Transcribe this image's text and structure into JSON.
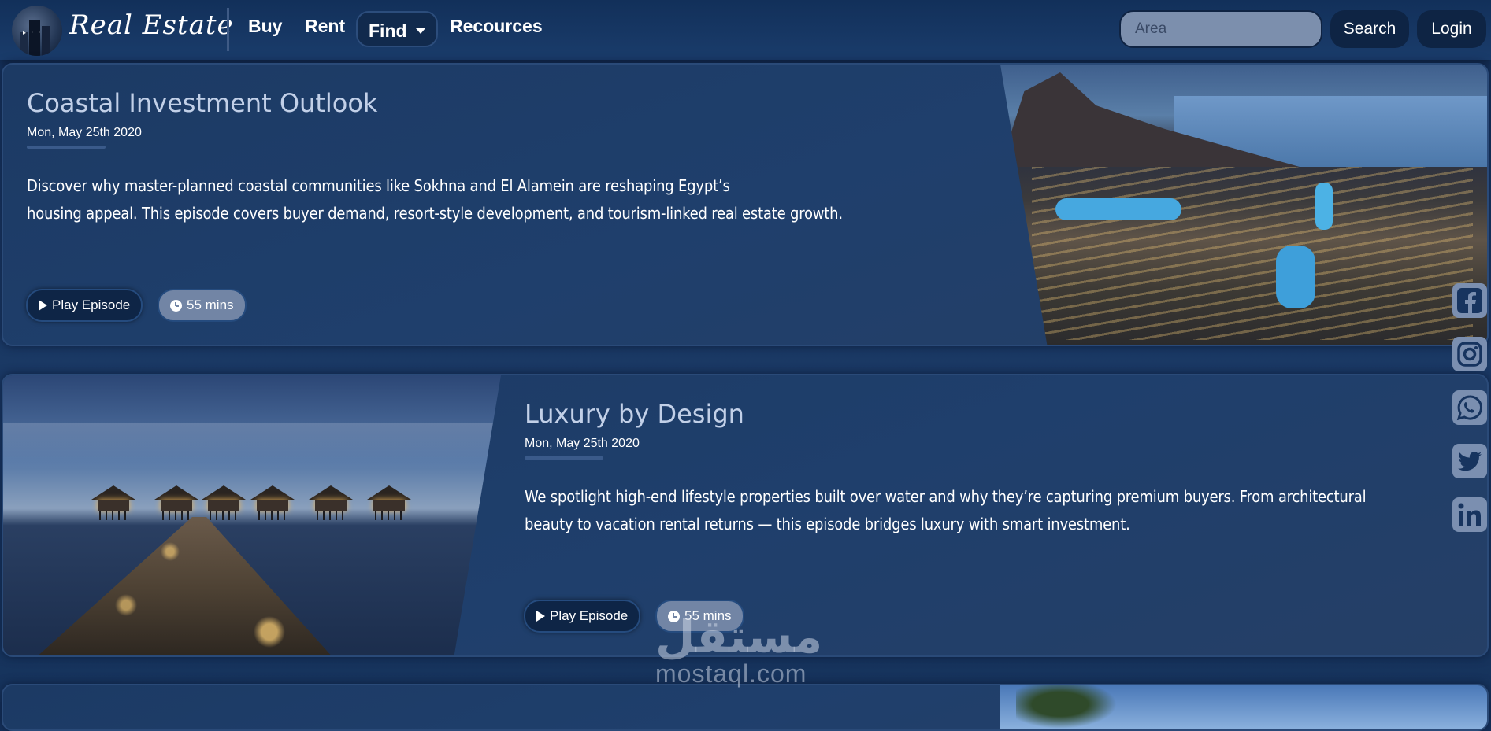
{
  "nav": {
    "brand": "Real Estate",
    "links": [
      "Buy",
      "Rent",
      "Find",
      "Recources"
    ],
    "search_placeholder": "Area",
    "search_label": "Search",
    "login_label": "Login"
  },
  "episodes": [
    {
      "title": "Coastal Investment Outlook",
      "date": "Mon, May 25th 2020",
      "description_line1": "Discover why master-planned coastal communities like Sokhna and El Alamein are reshaping Egypt’s",
      "description_line2": "housing appeal. This episode covers buyer demand, resort-style development, and tourism-linked real estate growth.",
      "play_label": "Play Episode",
      "duration": "55 mins"
    },
    {
      "title": "Luxury by Design",
      "date": "Mon, May 25th 2020",
      "description_line1": "We spotlight high-end lifestyle properties built over water and why they’re capturing premium buyers. From architectural",
      "description_line2": "beauty to vacation rental returns — this episode bridges luxury with smart investment.",
      "play_label": "Play Episode",
      "duration": "55 mins"
    }
  ],
  "social": [
    "facebook-icon",
    "instagram-icon",
    "whatsapp-icon",
    "twitter-icon",
    "linkedin-icon"
  ],
  "watermark": {
    "arabic": "مستقل",
    "latin": "mostaql.com"
  },
  "colors": {
    "background": "#1b3a66",
    "accent_dark": "#0e2444",
    "badge": "#7285a5",
    "title": "#c2d0e8"
  }
}
